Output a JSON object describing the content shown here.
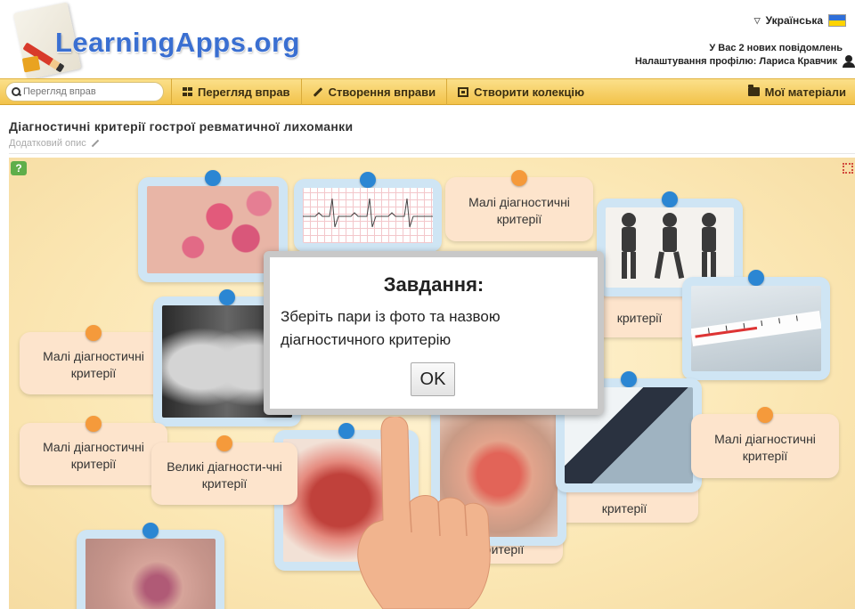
{
  "header": {
    "logo_text": "LearningApps.org",
    "language": "Українська",
    "messages": "У Вас 2 нових повідомлень",
    "profile": "Налаштування профілю: Лариса Кравчик"
  },
  "navbar": {
    "search_placeholder": "Перегляд вправ",
    "browse": "Перегляд вправ",
    "create": "Створення вправи",
    "collection": "Створити колекцію",
    "materials": "Мої матеріали"
  },
  "page": {
    "title": "Діагностичні критерії гострої ревматичної лихоманки",
    "description": "Додатковий опис"
  },
  "cards": {
    "minor": "Малі діагностичні критерії",
    "major": "Великі діагности-чні критерії",
    "partial_criteria": "критерії",
    "partial_ritery": "ритерії"
  },
  "modal": {
    "title": "Завдання:",
    "text": "Зберіть пари із фото та назвою діагностичного критерію",
    "ok": "OK"
  },
  "colors": {
    "navbar": "#f2c24a",
    "board": "#fbe7b4",
    "text_card": "#fde4cc",
    "photo_card": "#cfe5f4",
    "pin_blue": "#2b86d3",
    "pin_orange": "#f59a3b"
  }
}
